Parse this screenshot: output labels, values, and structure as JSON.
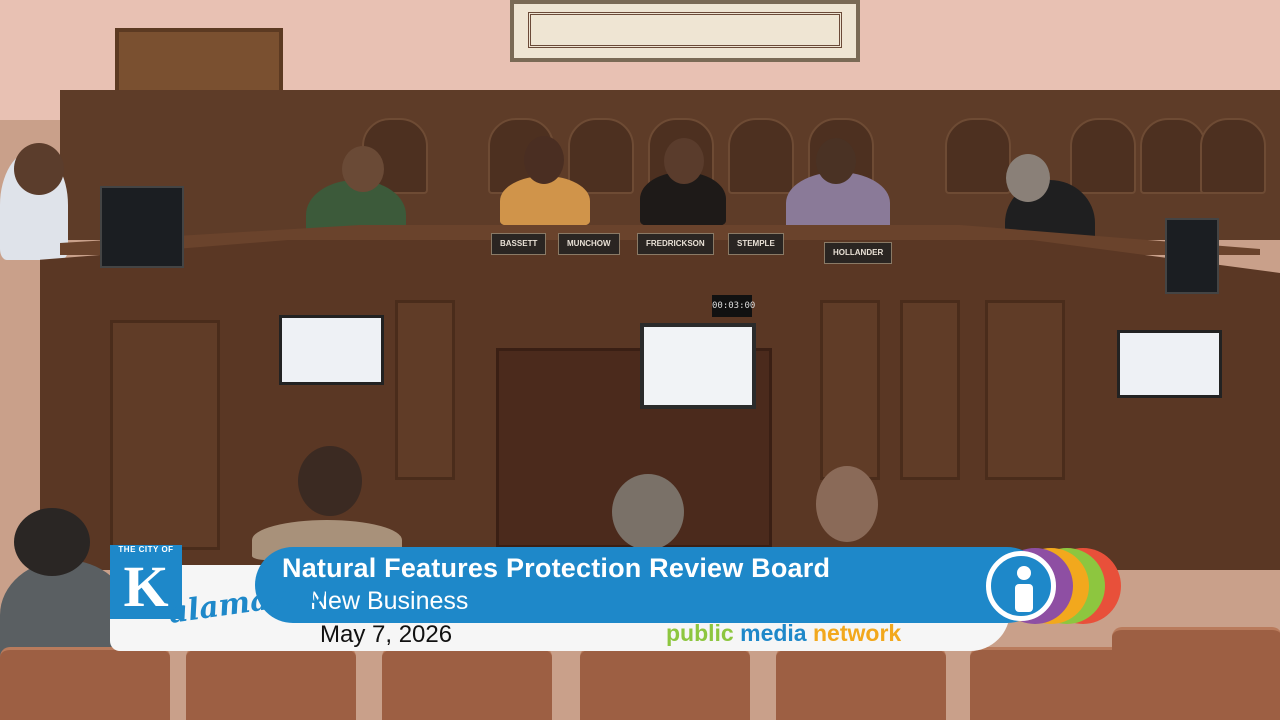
{
  "broadcast": {
    "title": "Natural Features Protection Review Board",
    "subtitle": "New Business",
    "date": "May 7, 2026"
  },
  "network": {
    "word1": "public",
    "word2": "media",
    "word3": "network",
    "colors": [
      "#8dc63f",
      "#1e88c9",
      "#f2a81d"
    ]
  },
  "logo": {
    "top_text": "THE CITY OF",
    "initial": "K",
    "script": "alamazoo",
    "icon": "city-of-kalamazoo-logo"
  },
  "info_icon": "info-person-icon",
  "rings_colors": [
    "#8e4fa3",
    "#f2a81d",
    "#8dc63f",
    "#e8503a"
  ],
  "nameplates": [
    "BASSETT",
    "MUNCHOW",
    "FREDRICKSON",
    "STEMPLE",
    "HOLLANDER"
  ],
  "timer": "00:03:00"
}
